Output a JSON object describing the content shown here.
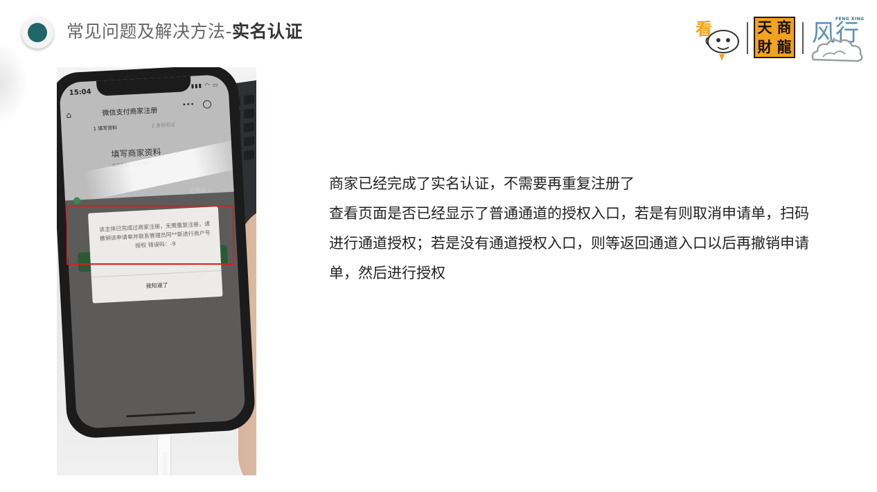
{
  "header": {
    "title_prefix": "常见问题及解决方法-",
    "title_bold": "实名认证"
  },
  "logos": {
    "kan": "看",
    "tsl": [
      "天",
      "商",
      "財",
      "龍"
    ],
    "fengxing": "风行",
    "fengxing_small": "FENG XING"
  },
  "phone": {
    "clock": "15:04",
    "status_icons": "▮▮▮ ◠ ▭",
    "nav_home": "⌂",
    "nav_title": "微信支付商家注册",
    "nav_more": "•••",
    "step1": "1 填写资料",
    "step2": "2 身份验证",
    "form_title": "填写商家资料",
    "form_sub": "主体类型：企业  律师",
    "done_label": "已完成 >",
    "dialog_text": "该主体已完成过商家注册，无需重复注册，请撤销该申请单并联系管理员阿**斯进行商户号授权 错误码：-9",
    "dialog_ok": "我知道了"
  },
  "content": {
    "line1": "商家已经完成了实名认证，不需要再重复注册了",
    "line2": "查看页面是否已经显示了普通通道的授权入口，若是有则取消申请单，扫码进行通道授权；若是没有通道授权入口，则等返回通道入口以后再撤销申请单，然后进行授权"
  },
  "colors": {
    "accent_teal": "#1f6668",
    "highlight_red": "#e01b1b",
    "logo_orange": "#f1a21f"
  }
}
